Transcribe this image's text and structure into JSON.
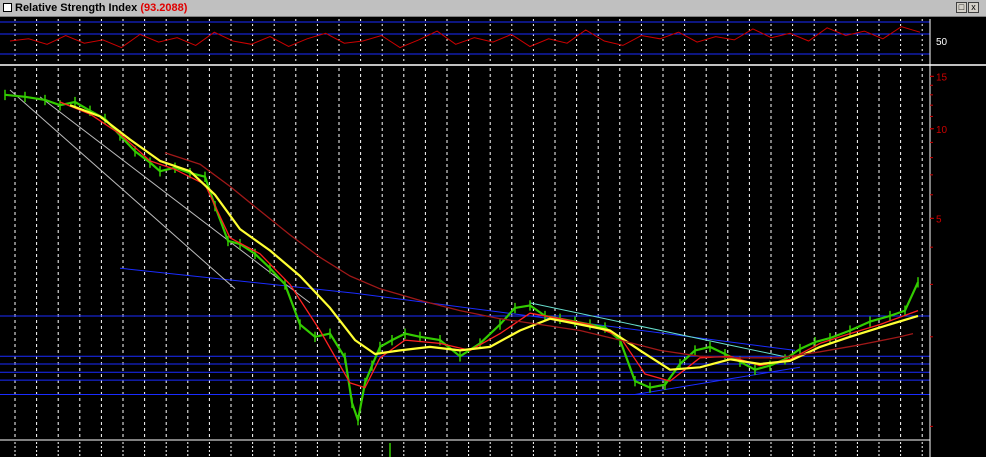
{
  "window": {
    "title": "Relative Strength Index",
    "title_value": "(93.2088)",
    "restore_label": "□",
    "close_label": "x"
  },
  "colors": {
    "background": "#000000",
    "grid_dots": "#ffffff",
    "rsi_line": "#cc0000",
    "price_bars": "#33cc00",
    "ma_red": "#ff2020",
    "ma_yellow": "#ffff33",
    "ma_dark_red": "#a01818",
    "horizontal_lines": "#1a2cff",
    "trendline_blue": "#1a2cff",
    "trendline_cyan": "#66ddcc",
    "channel_white": "#bbbbbb",
    "price_axis_text": "#cc0000",
    "rsi_axis_text": "#ffffff"
  },
  "chart_data": [
    {
      "type": "line",
      "title": "Relative Strength Index",
      "series": [
        {
          "name": "Relative Strength Index",
          "values": [
            50,
            52,
            47,
            55,
            48,
            51,
            44,
            56,
            49,
            53,
            46,
            58,
            50,
            47,
            54,
            45,
            52,
            57,
            48,
            50,
            55,
            44,
            51,
            59,
            47,
            53,
            49,
            56,
            45,
            52,
            48,
            60,
            50,
            46,
            55,
            52,
            58,
            49,
            54,
            51,
            61,
            53,
            57,
            50,
            62,
            55,
            59,
            52,
            63,
            58
          ]
        }
      ],
      "y_ticks": [
        "50"
      ],
      "last_value": 93.2088
    },
    {
      "type": "line",
      "y_scale": "log",
      "y_ticks": [
        "15",
        "10",
        "5"
      ],
      "ylim": [
        0.9,
        16
      ],
      "horizontal_levels": [
        2.35,
        1.72,
        1.62,
        1.52,
        1.43,
        1.28
      ],
      "trendlines": [
        {
          "from": [
            120,
            3.4
          ],
          "to": [
            355,
            2.8
          ],
          "color_key": "trendline_blue"
        },
        {
          "from": [
            355,
            2.8
          ],
          "to": [
            795,
            1.8
          ],
          "color_key": "trendline_blue"
        },
        {
          "from": [
            530,
            2.6
          ],
          "to": [
            790,
            1.7
          ],
          "color_key": "trendline_cyan"
        },
        {
          "from": [
            635,
            1.28
          ],
          "to": [
            800,
            1.58
          ],
          "color_key": "trendline_blue"
        },
        {
          "from": [
            10,
            13.5
          ],
          "to": [
            235,
            2.9
          ],
          "color_key": "channel_white"
        },
        {
          "from": [
            40,
            12.8
          ],
          "to": [
            310,
            2.6
          ],
          "color_key": "channel_white"
        }
      ],
      "series": [
        {
          "color_key": "price_bars",
          "x": [
            5,
            25,
            45,
            60,
            75,
            90,
            105,
            120,
            135,
            150,
            160,
            175,
            190,
            205,
            215,
            228,
            240,
            255,
            270,
            285,
            300,
            315,
            330,
            345,
            352,
            358,
            365,
            372,
            380,
            392,
            405,
            420,
            440,
            460,
            480,
            500,
            515,
            530,
            545,
            560,
            575,
            590,
            605,
            620,
            635,
            650,
            665,
            680,
            695,
            710,
            725,
            740,
            755,
            770,
            785,
            800,
            815,
            830,
            850,
            870,
            890,
            905,
            918
          ],
          "values": [
            13.0,
            12.8,
            12.5,
            12.0,
            12.3,
            11.5,
            10.8,
            9.5,
            8.4,
            7.7,
            7.2,
            7.4,
            7.1,
            6.9,
            5.5,
            4.2,
            4.1,
            3.8,
            3.4,
            3.0,
            2.2,
            2.0,
            2.05,
            1.7,
            1.2,
            1.05,
            1.4,
            1.6,
            1.85,
            1.95,
            2.05,
            2.0,
            1.95,
            1.72,
            1.9,
            2.2,
            2.5,
            2.55,
            2.35,
            2.3,
            2.25,
            2.2,
            2.15,
            1.95,
            1.42,
            1.35,
            1.38,
            1.62,
            1.8,
            1.85,
            1.75,
            1.65,
            1.55,
            1.6,
            1.68,
            1.82,
            1.92,
            1.98,
            2.1,
            2.25,
            2.35,
            2.45,
            3.05
          ]
        },
        {
          "color_key": "ma_red",
          "x": [
            60,
            90,
            120,
            150,
            175,
            205,
            230,
            260,
            290,
            320,
            350,
            365,
            380,
            405,
            440,
            470,
            500,
            530,
            560,
            590,
            620,
            645,
            670,
            700,
            730,
            760,
            790,
            820,
            850,
            880,
            918
          ],
          "values": [
            12.3,
            11.2,
            9.6,
            7.8,
            7.3,
            6.5,
            4.3,
            3.8,
            3.0,
            2.1,
            1.4,
            1.35,
            1.7,
            1.95,
            1.9,
            1.8,
            2.05,
            2.4,
            2.3,
            2.2,
            2.0,
            1.5,
            1.42,
            1.7,
            1.72,
            1.6,
            1.68,
            1.9,
            2.05,
            2.2,
            2.45
          ]
        },
        {
          "color_key": "ma_yellow",
          "x": [
            70,
            100,
            130,
            160,
            190,
            215,
            240,
            270,
            300,
            330,
            355,
            375,
            400,
            430,
            460,
            490,
            520,
            550,
            580,
            610,
            640,
            670,
            700,
            730,
            760,
            790,
            820,
            850,
            880,
            918
          ],
          "values": [
            12.0,
            11.0,
            9.2,
            7.8,
            7.2,
            6.0,
            4.6,
            3.9,
            3.2,
            2.5,
            1.95,
            1.75,
            1.8,
            1.85,
            1.8,
            1.85,
            2.1,
            2.3,
            2.2,
            2.1,
            1.8,
            1.55,
            1.58,
            1.68,
            1.62,
            1.66,
            1.85,
            2.0,
            2.15,
            2.35
          ]
        },
        {
          "color_key": "ma_dark_red",
          "x": [
            165,
            200,
            230,
            260,
            290,
            320,
            350,
            380,
            420,
            460,
            500,
            540,
            580,
            620,
            660,
            700,
            740,
            780,
            820,
            860,
            900,
            913
          ],
          "values": [
            8.3,
            7.6,
            6.4,
            5.3,
            4.4,
            3.7,
            3.2,
            2.9,
            2.65,
            2.45,
            2.3,
            2.2,
            2.1,
            1.95,
            1.8,
            1.72,
            1.7,
            1.7,
            1.78,
            1.88,
            2.0,
            2.05
          ]
        }
      ]
    }
  ]
}
